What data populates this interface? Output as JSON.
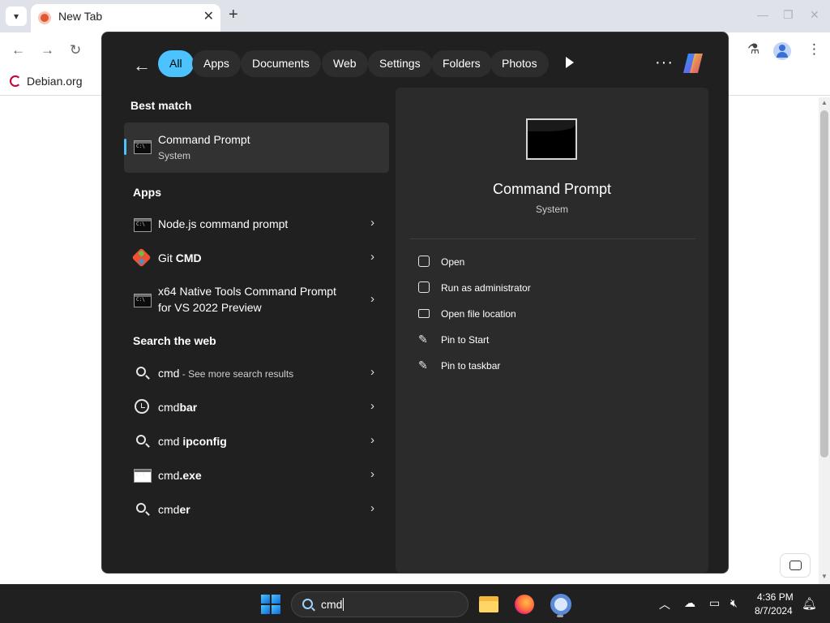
{
  "browser": {
    "tab_title": "New Tab",
    "tab_close": "✕",
    "new_tab": "+",
    "bookmarks": [
      "Debian.org"
    ],
    "window_controls": {
      "minimize": "—",
      "restore": "❐",
      "close": "✕"
    }
  },
  "search_panel": {
    "filters": [
      "All",
      "Apps",
      "Documents",
      "Web",
      "Settings",
      "Folders",
      "Photos"
    ],
    "active_filter": "All",
    "more": "···",
    "best_match": {
      "header": "Best match",
      "name": "Command Prompt",
      "type": "System"
    },
    "apps": {
      "header": "Apps",
      "items": [
        {
          "name": "Node.js command prompt",
          "bold": ""
        },
        {
          "name": "Git ",
          "bold": "CMD"
        },
        {
          "name": "x64 Native Tools Command Prompt for VS 2022 Preview",
          "bold": ""
        }
      ]
    },
    "web": {
      "header": "Search the web",
      "items": [
        {
          "prefix": "cmd",
          "bold": "",
          "suffix": " - See more search results"
        },
        {
          "prefix": "cmd",
          "bold": "bar",
          "suffix": ""
        },
        {
          "prefix": "cmd ",
          "bold": "ipconfig",
          "suffix": ""
        },
        {
          "prefix": "cmd",
          "bold": ".exe",
          "suffix": ""
        },
        {
          "prefix": "cmd",
          "bold": "er",
          "suffix": ""
        }
      ]
    },
    "detail": {
      "name": "Command Prompt",
      "type": "System",
      "actions": [
        "Open",
        "Run as administrator",
        "Open file location",
        "Pin to Start",
        "Pin to taskbar"
      ]
    }
  },
  "taskbar": {
    "search_value": "cmd",
    "time": "4:36 PM",
    "date": "8/7/2024"
  },
  "colors": {
    "accent": "#4cc2ff",
    "panel_bg": "#202020",
    "detail_bg": "#2b2b2b"
  },
  "icons": [
    "back-arrow-icon",
    "play-icon",
    "copilot-icon",
    "terminal-icon",
    "git-icon",
    "search-icon",
    "history-icon",
    "chevron-right-icon",
    "open-icon",
    "shield-icon",
    "folder-icon",
    "pin-icon",
    "windows-logo-icon",
    "file-explorer-icon",
    "firefox-icon",
    "chrome-icon",
    "bell-icon"
  ]
}
